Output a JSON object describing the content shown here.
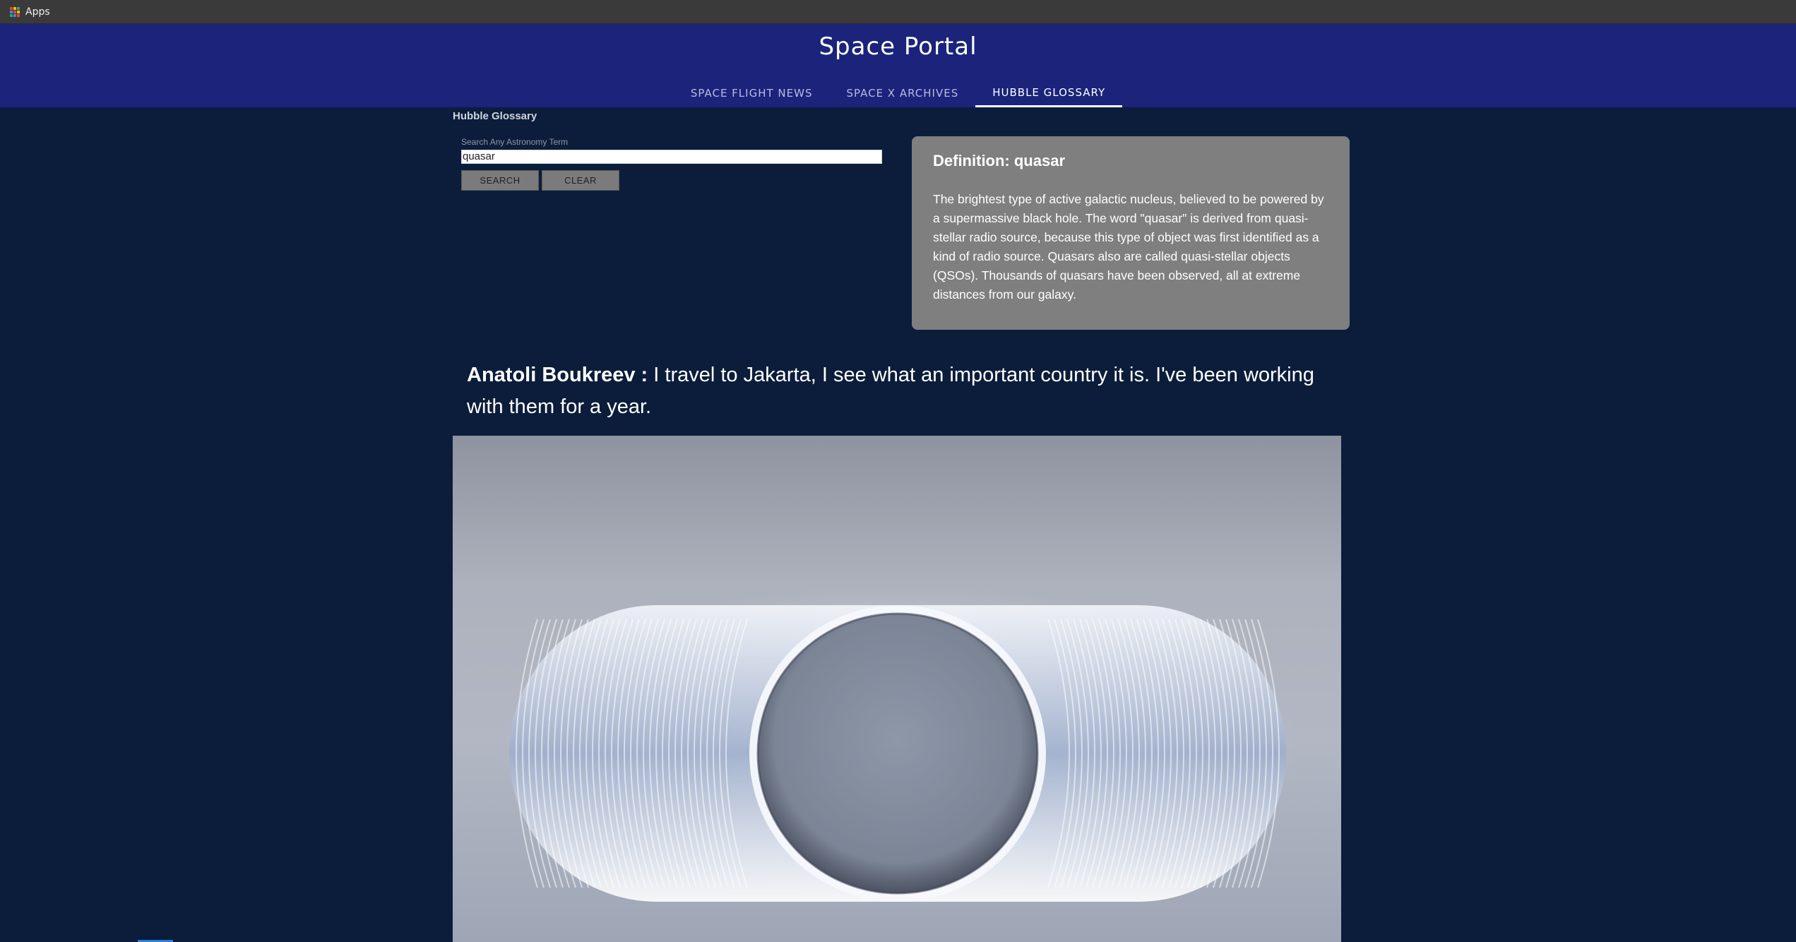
{
  "browser": {
    "bookmarks_bar": {
      "apps_label": "Apps",
      "apps_icon_colors": [
        "#ea4335",
        "#fbbc05",
        "#34a853",
        "#4285f4",
        "#ea4335",
        "#fbbc05",
        "#34a853",
        "#4285f4",
        "#ea4335"
      ]
    }
  },
  "header": {
    "title": "Space Portal",
    "nav": [
      {
        "label": "SPACE FLIGHT NEWS",
        "active": false
      },
      {
        "label": "SPACE X ARCHIVES",
        "active": false
      },
      {
        "label": "HUBBLE GLOSSARY",
        "active": true
      }
    ]
  },
  "main": {
    "page_heading": "Hubble Glossary",
    "search": {
      "label": "Search Any Astronomy Term",
      "value": "quasar",
      "search_label": "SEARCH",
      "clear_label": "CLEAR"
    },
    "definition": {
      "title": "Definition: quasar",
      "text": "The brightest type of active galactic nucleus, believed to be powered by a supermassive black hole. The word \"quasar\" is derived from quasi-stellar radio source, because this type of object was first identified as a kind of radio source. Quasars also are called quasi-stellar objects (QSOs). Thousands of quasars have been observed, all at extreme distances from our galaxy."
    },
    "quote": {
      "author": "Anatoli Boukreev :",
      "text": "I travel to Jakarta, I see what an important country it is. I've been working with them for a year."
    },
    "image": {
      "icon": "ringed-sphere-image"
    }
  },
  "colors": {
    "page_bg": "#0b1d3a",
    "header_bg": "#1b237b",
    "card_bg": "#7f7f7f",
    "button_bg": "#7b7b7b"
  }
}
